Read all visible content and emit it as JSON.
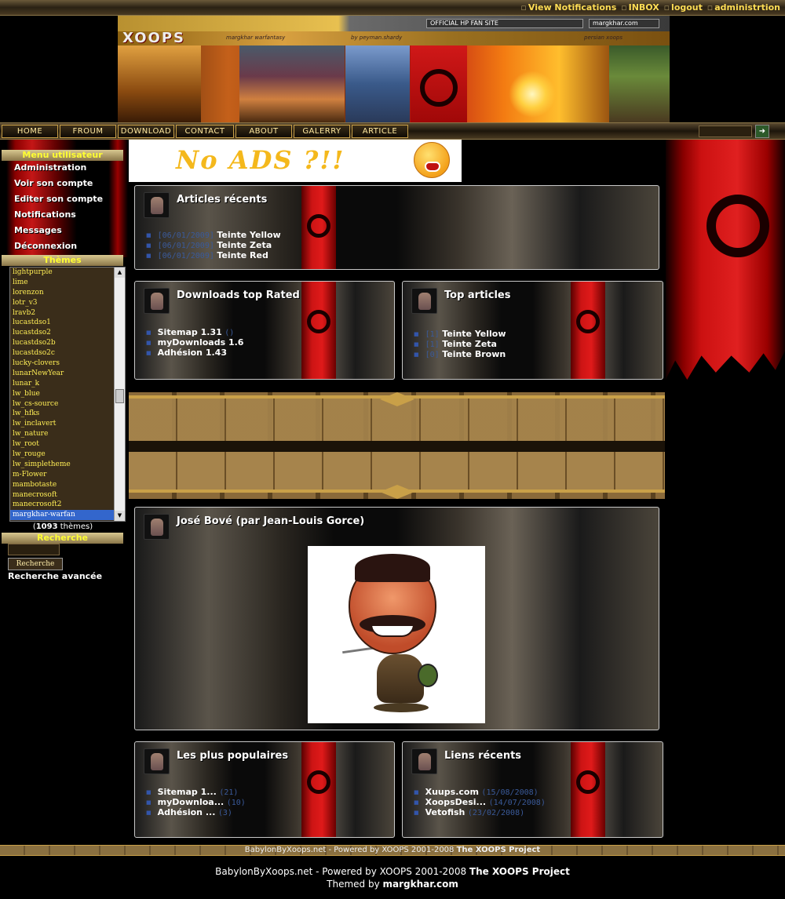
{
  "topbar": {
    "links": [
      "View Notifications",
      "INBOX",
      "logout",
      "administrtion"
    ]
  },
  "header": {
    "logo": "XOOPS",
    "tagline_left": "margkhar warfantasy",
    "tagline_mid": "by peyman.shardy",
    "tagline_right": "persian xoops",
    "official_label": "OFFICIAL HP FAN SITE",
    "site_label": "margkhar.com"
  },
  "nav": {
    "items": [
      "HOME",
      "FROUM",
      "DOWNLOAD",
      "CONTACT",
      "ABOUT",
      "GALERRY",
      "ARTICLE"
    ]
  },
  "sidebar": {
    "user_menu_title": "Menu utilisateur",
    "user_menu": [
      "Administration",
      "Voir son compte",
      "Editer son compte",
      "Notifications",
      "Messages",
      "Déconnexion"
    ],
    "themes_title": "Thèmes",
    "themes": [
      "lightpurple",
      "lime",
      "lorenzon",
      "lotr_v3",
      "lravb2",
      "lucastdso1",
      "lucastdso2",
      "lucastdso2b",
      "lucastdso2c",
      "lucky-clovers",
      "lunarNewYear",
      "lunar_k",
      "lw_blue",
      "lw_cs-source",
      "lw_hfks",
      "lw_inclavert",
      "lw_nature",
      "lw_root",
      "lw_rouge",
      "lw_simpletheme",
      "m-Flower",
      "mambotaste",
      "manecrosoft",
      "manecrosoft2",
      "margkhar-warfan"
    ],
    "selected_theme": "margkhar-warfan",
    "theme_count": "1093",
    "theme_count_suffix": " thèmes)",
    "theme_count_prefix": "(",
    "search_title": "Recherche",
    "search_button": "Recherche",
    "advanced_search": "Recherche avancée"
  },
  "ad": {
    "text": "No ADS ?!!"
  },
  "boxes": {
    "articles_recents": {
      "title": "Articles récents",
      "items": [
        {
          "date": "[06/01/2009]",
          "label": "Teinte Yellow"
        },
        {
          "date": "[06/01/2009]",
          "label": "Teinte Zeta"
        },
        {
          "date": "[06/01/2009]",
          "label": "Teinte Red"
        }
      ]
    },
    "downloads_top": {
      "title": "Downloads top Rated",
      "items": [
        {
          "label": "Sitemap 1.31",
          "count": "()"
        },
        {
          "label": "myDownloads 1.6",
          "count": ""
        },
        {
          "label": "Adhésion 1.43",
          "count": ""
        }
      ]
    },
    "top_articles": {
      "title": "Top articles",
      "items": [
        {
          "count": "[1]",
          "label": "Teinte Yellow"
        },
        {
          "count": "[1]",
          "label": "Teinte Zeta"
        },
        {
          "count": "[0]",
          "label": "Teinte Brown"
        }
      ]
    },
    "jose": {
      "title": "José Bové (par Jean-Louis Gorce)"
    },
    "populaires": {
      "title": "Les plus populaires",
      "items": [
        {
          "label": "Sitemap 1...",
          "count": "(21)"
        },
        {
          "label": "myDownloa...",
          "count": "(10)"
        },
        {
          "label": "Adhésion ...",
          "count": "(3)"
        }
      ]
    },
    "liens": {
      "title": "Liens récents",
      "items": [
        {
          "label": "Xuups.com",
          "count": "(15/08/2008)"
        },
        {
          "label": "XoopsDesi...",
          "count": "(14/07/2008)"
        },
        {
          "label": "Vetofish",
          "count": "(23/02/2008)"
        }
      ]
    }
  },
  "footer": {
    "bar_text": "BabylonByXoops.net - Powered by XOOPS 2001-2008 ",
    "bar_bold": "The XOOPS Project",
    "line1_text": "BabylonByXoops.net - Powered by XOOPS 2001-2008 ",
    "line1_bold": "The XOOPS Project",
    "line2_text": "Themed by ",
    "line2_bold": "margkhar.com"
  }
}
